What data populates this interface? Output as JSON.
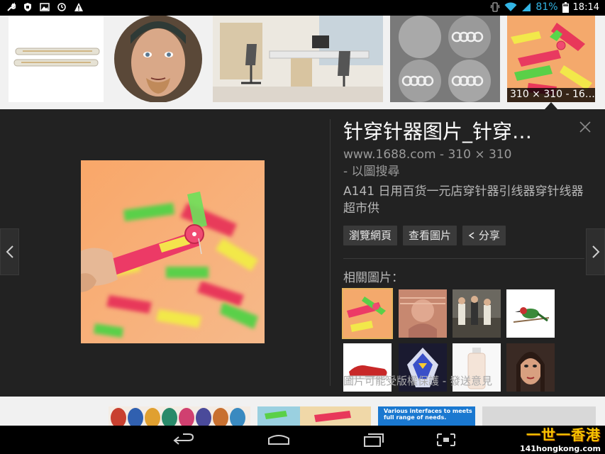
{
  "status_bar": {
    "battery_percent": "81%",
    "time": "18:14",
    "accent_color": "#33b5e5",
    "left_icons": [
      "wrench-icon",
      "shield-icon",
      "image-icon",
      "sync-icon",
      "warning-icon"
    ],
    "right_icons": [
      "vibrate-icon",
      "wifi-icon",
      "signal-icon",
      "battery-icon"
    ]
  },
  "top_strip": {
    "selected_dimensions": "310 × 310 - 16…"
  },
  "detail": {
    "title": "针穿针器图片_针穿…",
    "source_line1": "www.1688.com - 310 × 310",
    "source_line2": " - 以圖搜尋",
    "description": "A141 日用百货一元店穿针器引线器穿针线器超市供",
    "buttons": {
      "visit": "瀏覽網頁",
      "view_image": "查看圖片",
      "share": "分享"
    },
    "related_label": "相關圖片：",
    "feedback_text": "圖片可能受版權保護 - 發送意見"
  },
  "bottom_strip": {
    "ad_text": "Various interfaces to meets full range of needs."
  },
  "watermark": {
    "name": "一世一香港",
    "url": "141hongkong.com"
  }
}
